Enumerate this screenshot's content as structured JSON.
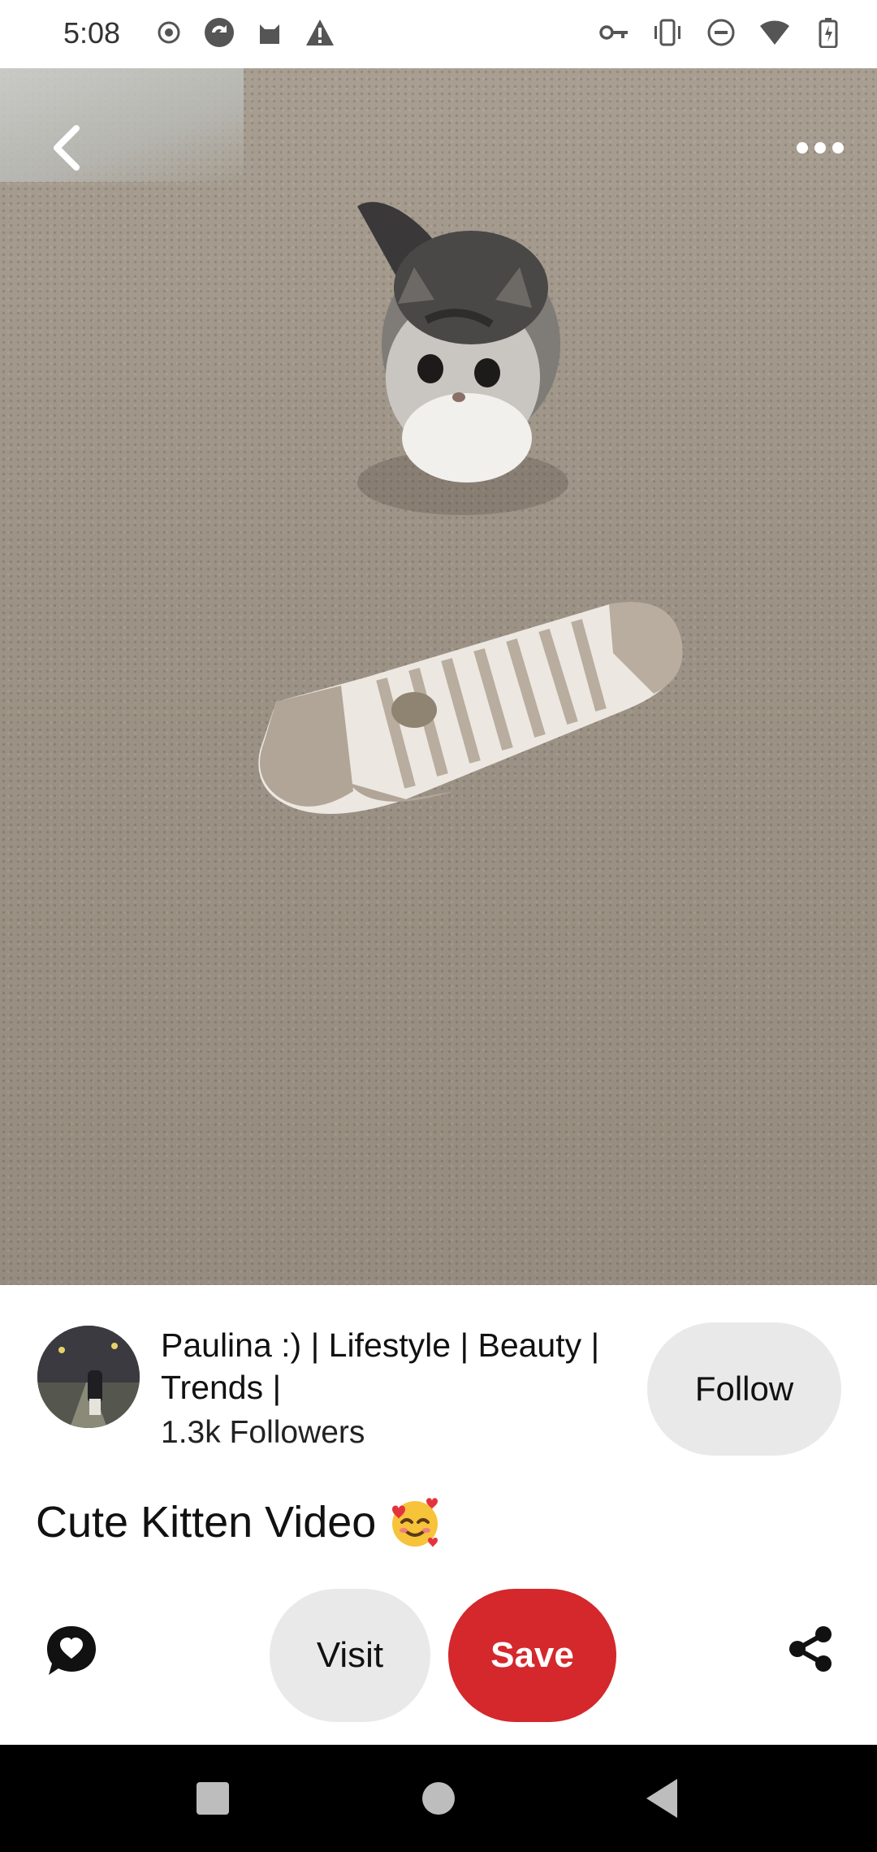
{
  "status_bar": {
    "time": "5:08",
    "left_icons": [
      "record-icon",
      "sync-icon",
      "cat-app-icon",
      "warning-icon"
    ],
    "right_icons": [
      "key-icon",
      "vibrate-icon",
      "dnd-icon",
      "wifi-icon",
      "battery-icon"
    ]
  },
  "media": {
    "description_icons": [
      "back-icon",
      "more-icon"
    ]
  },
  "creator": {
    "name": "Paulina :) | Lifestyle | Beauty | Trends |",
    "followers": "1.3k Followers",
    "follow_label": "Follow"
  },
  "pin": {
    "title": "Cute Kitten Video",
    "emoji": "🥰"
  },
  "actions": {
    "visit_label": "Visit",
    "save_label": "Save",
    "save_color": "#d4282c"
  },
  "nav": {
    "icons": [
      "recents-icon",
      "home-icon",
      "back-icon"
    ]
  }
}
